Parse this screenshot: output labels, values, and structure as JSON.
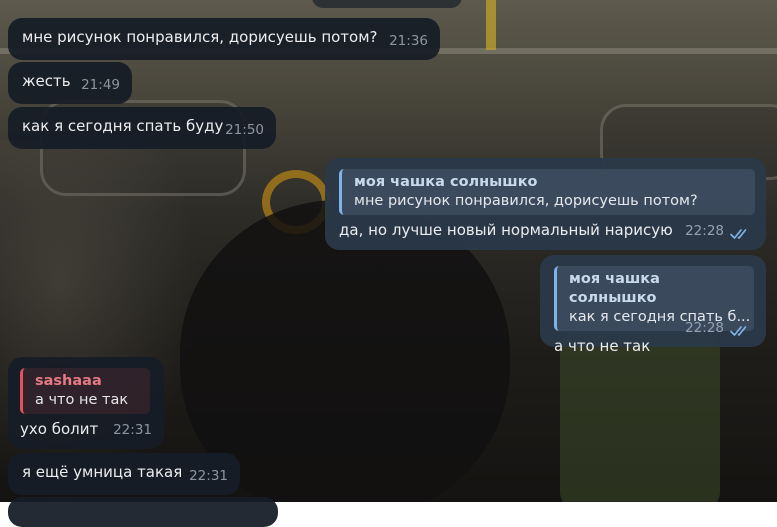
{
  "messages": [
    {
      "id": "m1",
      "direction": "incoming",
      "text": "мне рисунок понравился, дорисуешь потом?",
      "time": "21:36"
    },
    {
      "id": "m2",
      "direction": "incoming",
      "text": "жесть",
      "time": "21:49"
    },
    {
      "id": "m3",
      "direction": "incoming",
      "text": "как я сегодня спать буду",
      "time": "21:50"
    },
    {
      "id": "m4",
      "direction": "outgoing",
      "reply_to": {
        "name": "моя чашка солнышко",
        "text": "мне рисунок понравился, дорисуешь потом?"
      },
      "text": "да, но лучше новый нормальный нарисую",
      "time": "22:28",
      "status": "read"
    },
    {
      "id": "m5",
      "direction": "outgoing",
      "reply_to": {
        "name": "моя чашка солнышко",
        "text": "как я сегодня спать б..."
      },
      "text": "а что не так",
      "time": "22:28",
      "status": "read"
    },
    {
      "id": "m6",
      "direction": "incoming",
      "reply_to": {
        "name": "sashaaa",
        "text": "а что не так"
      },
      "text": "ухо болит",
      "time": "22:31"
    },
    {
      "id": "m7",
      "direction": "incoming",
      "text": "я ещё умница такая",
      "time": "22:31"
    }
  ],
  "colors": {
    "incoming_bubble": "#161d26",
    "outgoing_bubble": "#2b3848",
    "reply_accent_blue": "#7fb3e8",
    "reply_accent_red": "#e0525c",
    "read_ticks": "#7fb3e8"
  },
  "icons": {
    "read_status": "double-check-icon"
  }
}
